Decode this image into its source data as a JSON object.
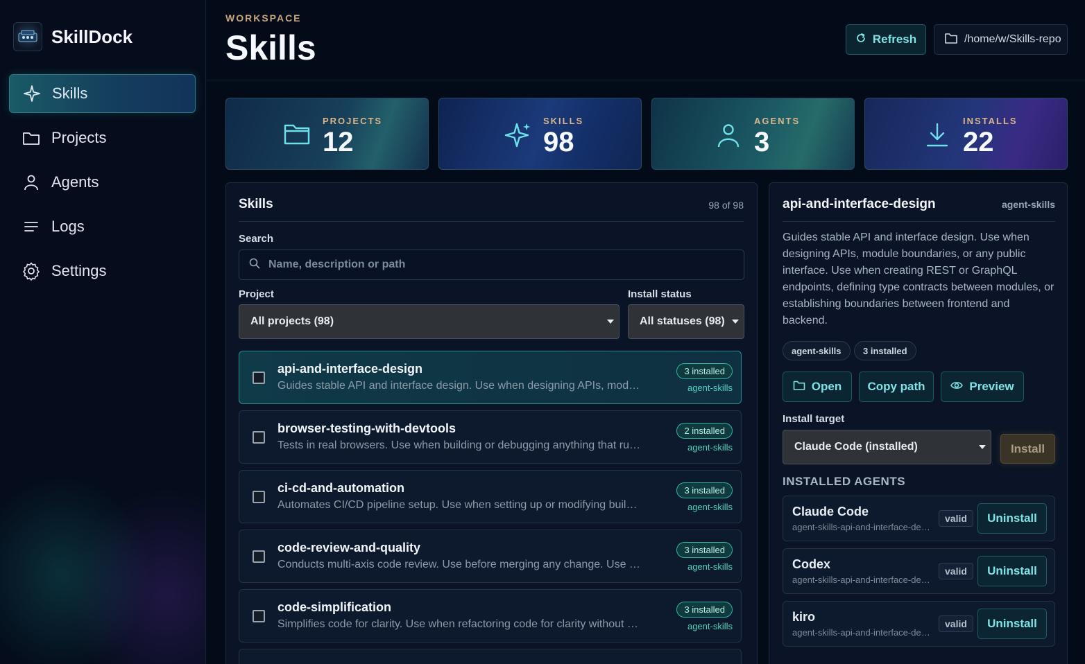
{
  "app": {
    "name": "SkillDock"
  },
  "sidebar": {
    "items": [
      {
        "label": "Skills",
        "icon": "sparkle-icon",
        "active": true
      },
      {
        "label": "Projects",
        "icon": "folder-icon"
      },
      {
        "label": "Agents",
        "icon": "person-icon"
      },
      {
        "label": "Logs",
        "icon": "list-icon"
      },
      {
        "label": "Settings",
        "icon": "gear-icon"
      }
    ]
  },
  "header": {
    "eyebrow": "WORKSPACE",
    "title": "Skills",
    "refresh_label": "Refresh",
    "path": "/home/w/Skills-repo"
  },
  "stats": [
    {
      "label": "PROJECTS",
      "value": "12",
      "icon": "folder-icon"
    },
    {
      "label": "SKILLS",
      "value": "98",
      "icon": "sparkle-icon"
    },
    {
      "label": "AGENTS",
      "value": "3",
      "icon": "person-icon"
    },
    {
      "label": "INSTALLS",
      "value": "22",
      "icon": "download-icon"
    }
  ],
  "skills_panel": {
    "title": "Skills",
    "count": "98 of 98",
    "search_label": "Search",
    "search_placeholder": "Name, description or path",
    "project_label": "Project",
    "project_value": "All projects (98)",
    "status_label": "Install status",
    "status_value": "All statuses (98)",
    "rows": [
      {
        "name": "api-and-interface-design",
        "desc": "Guides stable API and interface design. Use when designing APIs, module boundaries, or any public interface.",
        "badge": "3 installed",
        "source": "agent-skills",
        "selected": true
      },
      {
        "name": "browser-testing-with-devtools",
        "desc": "Tests in real browsers. Use when building or debugging anything that runs in a browser.",
        "badge": "2 installed",
        "source": "agent-skills"
      },
      {
        "name": "ci-cd-and-automation",
        "desc": "Automates CI/CD pipeline setup. Use when setting up or modifying build and deploy pipelines.",
        "badge": "3 installed",
        "source": "agent-skills"
      },
      {
        "name": "code-review-and-quality",
        "desc": "Conducts multi-axis code review. Use before merging any change. Use when reviewing code.",
        "badge": "3 installed",
        "source": "agent-skills"
      },
      {
        "name": "code-simplification",
        "desc": "Simplifies code for clarity. Use when refactoring code for clarity without changing behavior.",
        "badge": "3 installed",
        "source": "agent-skills"
      }
    ]
  },
  "detail": {
    "title": "api-and-interface-design",
    "source": "agent-skills",
    "description": "Guides stable API and interface design. Use when designing APIs, module boundaries, or any public interface. Use when creating REST or GraphQL endpoints, defining type contracts between modules, or establishing boundaries between frontend and backend.",
    "chips": [
      "agent-skills",
      "3 installed"
    ],
    "open_label": "Open",
    "copy_label": "Copy path",
    "preview_label": "Preview",
    "install_target_label": "Install target",
    "install_target_value": "Claude Code (installed)",
    "install_label": "Install",
    "installed_heading": "INSTALLED AGENTS",
    "agents": [
      {
        "name": "Claude Code",
        "path": "agent-skills-api-and-interface-design",
        "status": "valid",
        "action": "Uninstall"
      },
      {
        "name": "Codex",
        "path": "agent-skills-api-and-interface-design",
        "status": "valid",
        "action": "Uninstall"
      },
      {
        "name": "kiro",
        "path": "agent-skills-api-and-interface-design",
        "status": "valid",
        "action": "Uninstall"
      }
    ]
  },
  "colors": {
    "accent": "#7fe2e4",
    "badge_border": "#2fb5a7",
    "label_gold": "#d9b68b",
    "background": "#040b18"
  }
}
